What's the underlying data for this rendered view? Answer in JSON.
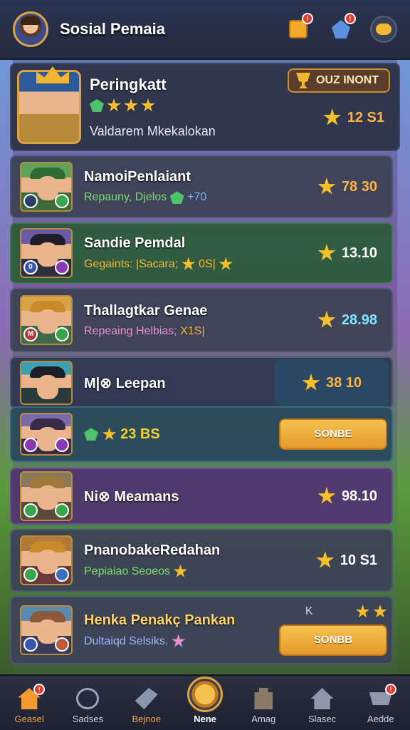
{
  "header": {
    "title": "Sosial Pemaia",
    "box_badge": "!",
    "gift_badge": "!"
  },
  "top_card": {
    "title": "Peringkatt",
    "subtitle": "Valdarem Mkekalokan",
    "pill": "OUZ INONT",
    "score": "12 S1"
  },
  "rows": [
    {
      "name": "NamoiPenlaiant",
      "sub": "Repauny, Djelos",
      "sub_extra": "+70",
      "score": "78 30",
      "sub_color": "#7fdc6a",
      "badge_left": "",
      "badge_right": ""
    },
    {
      "name": "Sandie Pemdal",
      "sub": "Gegaints: |Sacara;",
      "sub_extra": "0S|",
      "score": "13.10",
      "sub_color": "#f2b631",
      "badge_left": "0",
      "badge_right": ""
    },
    {
      "name": "Thallagtkar Genae",
      "sub": "Repeaing Helbias;",
      "sub_extra": "X1S|",
      "score": "28.98",
      "sub_color": "#e88fd4",
      "badge_left": "M",
      "badge_right": ""
    },
    {
      "name": "M|⊗ Leepan",
      "sub": "",
      "sub_extra": "",
      "score": "38 10",
      "sub_color": "#ffffff",
      "badge_left": "",
      "badge_right": ""
    },
    {
      "name": "",
      "sub": "23 BS",
      "sub_extra": "",
      "score": "",
      "sub_color": "#f2d12e",
      "button": "SONBE",
      "badge_left": "",
      "badge_right": ""
    },
    {
      "name": "Ni⊗ Meamans",
      "sub": "",
      "sub_extra": "",
      "score": "98.10",
      "sub_color": "#ffffff",
      "badge_left": "",
      "badge_right": ""
    },
    {
      "name": "PnanobakeRedahan",
      "sub": "Pepiaiao Seoeos",
      "sub_extra": "",
      "score": "10 S1",
      "sub_color": "#7fdc6a",
      "badge_left": "",
      "badge_right": ""
    },
    {
      "name": "Henka Penakç Pankan",
      "sub": "Dultaiqd Selsiks.",
      "sub_extra": "",
      "score": "",
      "sub_color": "#9fb6ff",
      "button": "SONBB",
      "side_label": "K",
      "badge_left": "",
      "badge_right": ""
    }
  ],
  "nav": [
    {
      "label": "Geasel",
      "icon": "home-icon",
      "badge": "!"
    },
    {
      "label": "Sadses",
      "icon": "clock-icon",
      "badge": ""
    },
    {
      "label": "Bejnoe",
      "icon": "tools-icon",
      "badge": ""
    },
    {
      "label": "Nene",
      "icon": "coin-icon",
      "badge": ""
    },
    {
      "label": "Amag",
      "icon": "tower-icon",
      "badge": ""
    },
    {
      "label": "Slasec",
      "icon": "house-icon",
      "badge": ""
    },
    {
      "label": "Aedde",
      "icon": "cart-icon",
      "badge": "!"
    }
  ]
}
